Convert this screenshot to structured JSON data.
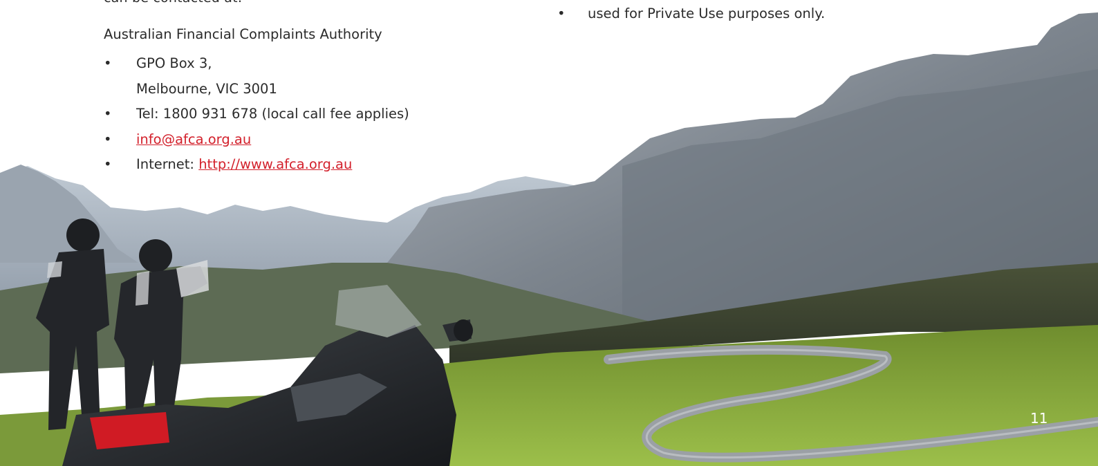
{
  "left_column": {
    "partial_heading": "can be contacted at:",
    "organisation": "Australian Financial Complaints Authority",
    "bullet": "•",
    "items": [
      {
        "line1": "GPO Box 3,",
        "line2": "Melbourne, VIC 3001"
      },
      {
        "text": "Tel: 1800 931 678 (local call fee applies)"
      },
      {
        "link": "info@afca.org.au"
      },
      {
        "prefix": "Internet: ",
        "link": "http://www.afca.org.au "
      }
    ]
  },
  "right_column": {
    "items": [
      {
        "text": "used for Private Use purposes only."
      }
    ]
  },
  "page_number": "11",
  "colors": {
    "link": "#d3212c",
    "text": "#2b2b2b",
    "sky": "#ffffff",
    "grass": "#7fa33a",
    "rock": "#8a9096",
    "road": "#8e9398"
  },
  "image_description_icons": [
    "mountain-landscape",
    "motorcycle",
    "riders"
  ]
}
